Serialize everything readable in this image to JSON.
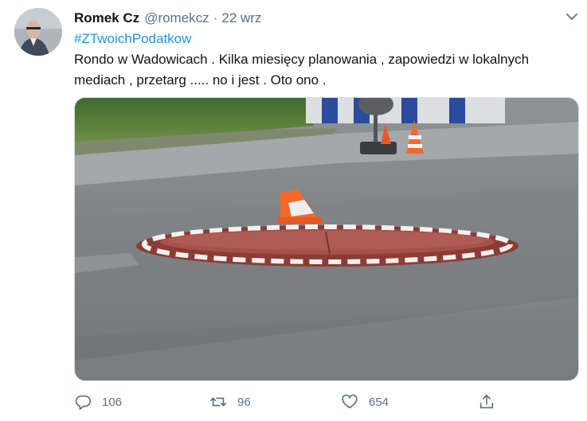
{
  "tweet": {
    "author": {
      "display_name": "Romek Cz",
      "handle": "@romekcz",
      "separator": "·",
      "date": "22 wrz"
    },
    "hashtag": "#ZTwoichPodatkow",
    "text": "Rondo w Wadowicach . Kilka miesięcy planowania , zapowiedzi w lokalnych mediach , przetarg ..... no i jest . Oto ono .",
    "media": {
      "kind": "photo"
    },
    "stats": {
      "replies": "106",
      "retweets": "96",
      "likes": "654"
    },
    "icons": {
      "menu": "chevron-down-icon",
      "reply": "speech-bubble-icon",
      "retweet": "retweet-arrows-icon",
      "like": "heart-icon",
      "share": "share-upload-icon"
    },
    "colors": {
      "text": "#0f1419",
      "secondary": "#5b7083",
      "link": "#1b95e0"
    }
  }
}
